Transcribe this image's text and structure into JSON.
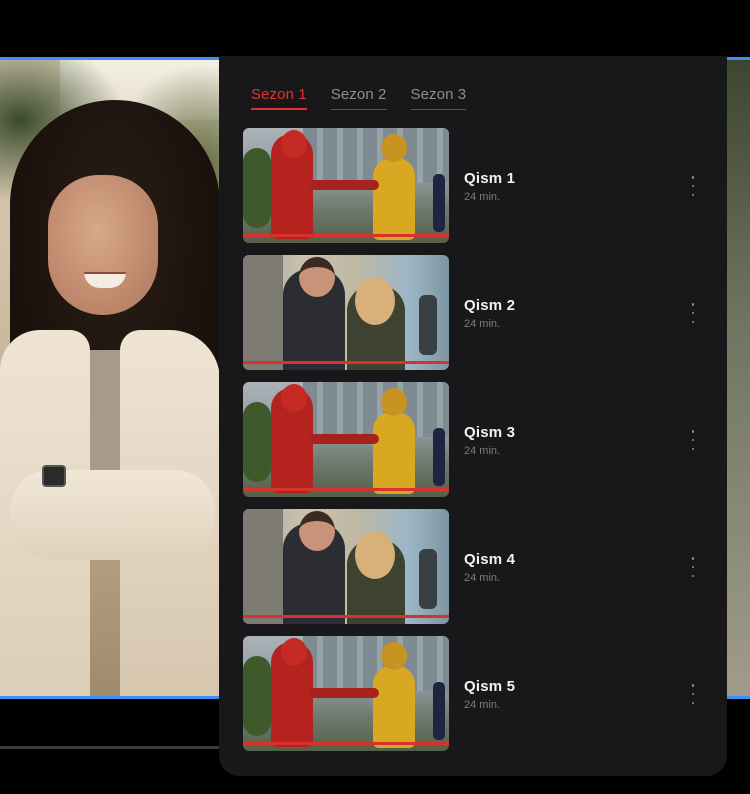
{
  "season_tabs": [
    {
      "label": "Sezon 1"
    },
    {
      "label": "Sezon 2"
    },
    {
      "label": "Sezon 3"
    }
  ],
  "episodes": [
    {
      "title": "Qism 1",
      "duration": "24 min.",
      "thumbnail": "superhero-scene"
    },
    {
      "title": "Qism 2",
      "duration": "24 min.",
      "thumbnail": "couple-hallway-scene"
    },
    {
      "title": "Qism 3",
      "duration": "24 min.",
      "thumbnail": "superhero-scene"
    },
    {
      "title": "Qism 4",
      "duration": "24 min.",
      "thumbnail": "couple-hallway-scene"
    },
    {
      "title": "Qism 5",
      "duration": "24 min.",
      "thumbnail": "superhero-scene"
    }
  ],
  "colors": {
    "accent": "#e5322d",
    "panel_bg": "#18181a",
    "highlight_line": "#3f8ff5",
    "muted_text": "#8e8e93"
  },
  "icons": {
    "episode_menu": "more-vertical-icon"
  }
}
